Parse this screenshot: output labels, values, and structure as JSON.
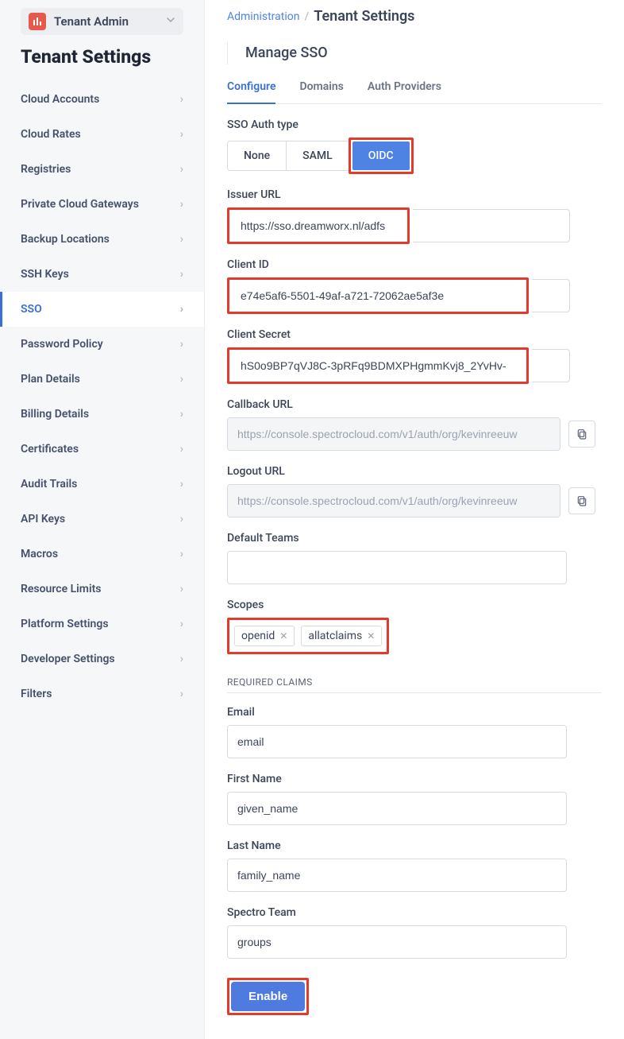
{
  "scope": {
    "label": "Tenant Admin"
  },
  "breadcrumb": {
    "link": "Administration",
    "current": "Tenant Settings"
  },
  "page_title": "Tenant Settings",
  "content_header": {
    "title": "Manage SSO"
  },
  "tabs": {
    "configure": "Configure",
    "domains": "Domains",
    "auth_providers": "Auth Providers"
  },
  "sidebar": {
    "items": [
      {
        "label": "Cloud Accounts"
      },
      {
        "label": "Cloud Rates"
      },
      {
        "label": "Registries"
      },
      {
        "label": "Private Cloud Gateways"
      },
      {
        "label": "Backup Locations"
      },
      {
        "label": "SSH Keys"
      },
      {
        "label": "SSO"
      },
      {
        "label": "Password Policy"
      },
      {
        "label": "Plan Details"
      },
      {
        "label": "Billing Details"
      },
      {
        "label": "Certificates"
      },
      {
        "label": "Audit Trails"
      },
      {
        "label": "API Keys"
      },
      {
        "label": "Macros"
      },
      {
        "label": "Resource Limits"
      },
      {
        "label": "Platform Settings"
      },
      {
        "label": "Developer Settings"
      },
      {
        "label": "Filters"
      }
    ]
  },
  "form": {
    "sso_auth_type_label": "SSO Auth type",
    "sso_auth_type": {
      "none": "None",
      "saml": "SAML",
      "oidc": "OIDC"
    },
    "issuer_url_label": "Issuer URL",
    "issuer_url": "https://sso.dreamworx.nl/adfs",
    "client_id_label": "Client ID",
    "client_id": "e74e5af6-5501-49af-a721-72062ae5af3e",
    "client_secret_label": "Client Secret",
    "client_secret": "hS0o9BP7qVJ8C-3pRFq9BDMXPHgmmKvj8_2YvHv-",
    "callback_url_label": "Callback URL",
    "callback_url": "https://console.spectrocloud.com/v1/auth/org/kevinreeuw",
    "logout_url_label": "Logout URL",
    "logout_url": "https://console.spectrocloud.com/v1/auth/org/kevinreeuw",
    "default_teams_label": "Default Teams",
    "scopes_label": "Scopes",
    "scopes": [
      "openid",
      "allatclaims"
    ],
    "required_claims_label": "REQUIRED CLAIMS",
    "email_label": "Email",
    "email": "email",
    "first_name_label": "First Name",
    "first_name": "given_name",
    "last_name_label": "Last Name",
    "last_name": "family_name",
    "spectro_team_label": "Spectro Team",
    "spectro_team": "groups",
    "enable_label": "Enable"
  }
}
